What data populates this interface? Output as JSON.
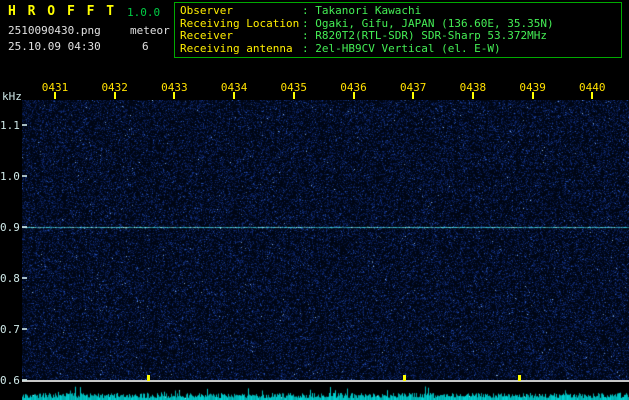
{
  "header": {
    "app_title": "H R O F F T",
    "version": "1.0.0",
    "filename": "2510090430.png",
    "mode": "meteor",
    "datetime": "25.10.09 04:30",
    "echo_count": "6",
    "info_rows": [
      {
        "label": "Observer",
        "value": ": Takanori Kawachi"
      },
      {
        "label": "Receiving Location",
        "value": ": Ogaki, Gifu, JAPAN (136.60E, 35.35N)"
      },
      {
        "label": "Receiver",
        "value": ": R820T2(RTL-SDR) SDR-Sharp 53.372MHz"
      },
      {
        "label": "Receiving antenna",
        "value": ": 2el-HB9CV Vertical (el. E-W)"
      }
    ]
  },
  "colors": {
    "title": "#ffff00",
    "version": "#00cc44",
    "text": "#e0e0e0",
    "info_label": "#ffee00",
    "info_value": "#44ee55",
    "info_border": "#00aa00"
  },
  "chart_data": {
    "type": "heatmap",
    "title": "",
    "xlabel": "",
    "ylabel": "kHz",
    "x_ticks": [
      "0431",
      "0432",
      "0433",
      "0434",
      "0435",
      "0436",
      "0437",
      "0438",
      "0439",
      "0440"
    ],
    "y_ticks": [
      "1.1",
      "1.0",
      "0.9",
      "0.8",
      "0.7",
      "0.6"
    ],
    "ylim_khz": [
      0.6,
      1.15
    ],
    "carrier_line_khz": 0.9,
    "echo_marker_fracs": [
      0.206,
      0.628,
      0.817
    ],
    "background_desc": "uniform dark-blue radio noise speckle, no meteor echo streaks visible",
    "bottom_strip_desc": "cyan signal-level trace along full width",
    "grid": false,
    "legend": false,
    "colors": {
      "background": "#000614",
      "noise_dim": "#0a1f5a",
      "noise_mid": "#14348c",
      "noise_bright": "#2a5cc8",
      "noise_peak": "#8cc0ff",
      "carrier": "#40d8e8",
      "carrier_bright": "#a0ffff",
      "level_trace": "#00d8d8",
      "level_peak": "#c8ffff",
      "tick": "#ffff00",
      "axis_text_x": "#ffe000",
      "axis_text_y": "#cfe8e8",
      "separator": "#c8c8c8"
    }
  }
}
